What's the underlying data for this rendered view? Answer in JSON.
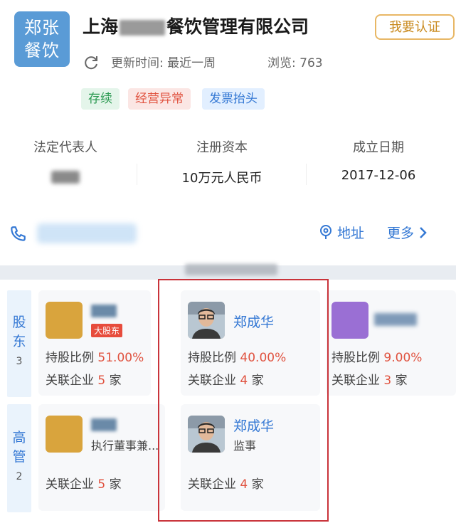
{
  "header": {
    "logo_line1": "郑张",
    "logo_line2": "餐饮",
    "company_prefix": "上海",
    "company_suffix": "餐饮管理有限公司",
    "verify_label": "我要认证",
    "update_label": "更新时间: 最近一周",
    "views_label": "浏览: 763",
    "tags": [
      "存续",
      "经营异常",
      "发票抬头"
    ]
  },
  "info": {
    "legal_rep_label": "法定代表人",
    "capital_label": "注册资本",
    "capital_value": "10万元人民币",
    "founded_label": "成立日期",
    "founded_value": "2017-12-06"
  },
  "contact": {
    "address_label": "地址",
    "more_label": "更多"
  },
  "shareholders": {
    "side_label_1": "股",
    "side_label_2": "东",
    "count": "3",
    "cards": [
      {
        "badge": "大股东",
        "ratio_label": "持股比例",
        "ratio": "51.00%",
        "assoc_label": "关联企业",
        "assoc_count": "5",
        "assoc_unit": "家"
      },
      {
        "name": "郑成华",
        "ratio_label": "持股比例",
        "ratio": "40.00%",
        "assoc_label": "关联企业",
        "assoc_count": "4",
        "assoc_unit": "家"
      },
      {
        "ratio_label": "持股比例",
        "ratio": "9.00%",
        "assoc_label": "关联企业",
        "assoc_count": "3",
        "assoc_unit": "家"
      }
    ]
  },
  "executives": {
    "side_label_1": "高",
    "side_label_2": "管",
    "count": "2",
    "cards": [
      {
        "role": "执行董事兼...",
        "assoc_label": "关联企业",
        "assoc_count": "5",
        "assoc_unit": "家"
      },
      {
        "name": "郑成华",
        "role": "监事",
        "assoc_label": "关联企业",
        "assoc_count": "4",
        "assoc_unit": "家"
      }
    ]
  }
}
